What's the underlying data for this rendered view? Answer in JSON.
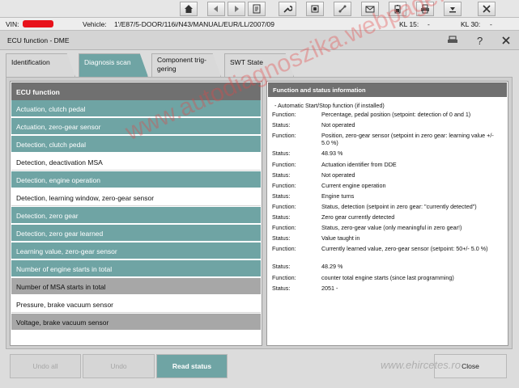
{
  "toolbar": {
    "buttons": [
      "home-icon",
      "back-icon",
      "forward-icon",
      "document-icon",
      "wrench-icon",
      "function-icon",
      "connection-icon",
      "mail-icon",
      "battery-icon",
      "print-icon",
      "dropdown-icon",
      "close-icon"
    ]
  },
  "infobar": {
    "vin_label": "VIN:",
    "vehicle_label": "Vehicle:",
    "vehicle_value": "1'/E87/5-DOOR/116i/N43/MANUAL/EUR/LL/2007/09",
    "kl15_label": "KL 15:",
    "kl15_value": "-",
    "kl30_label": "KL 30:",
    "kl30_value": "-"
  },
  "window": {
    "title": "ECU function - DME"
  },
  "tabs": [
    {
      "label": "Identification"
    },
    {
      "label": "Diagnosis scan"
    },
    {
      "label": "Component trig-\ngering"
    },
    {
      "label": "SWT State"
    }
  ],
  "ecu_panel": {
    "header": "ECU function",
    "rows": [
      "Actuation, clutch pedal",
      "Actuation, zero-gear sensor",
      "Detection, clutch pedal",
      "Detection, deactivation MSA",
      "Detection, engine operation",
      "Detection, learning window, zero-gear sensor",
      "Detection, zero gear",
      "Detection, zero gear learned",
      "Learning value, zero-gear sensor",
      "Number of engine starts in total",
      "Number of MSA starts in total",
      "Pressure, brake vacuum sensor",
      "Voltage, brake vacuum sensor"
    ]
  },
  "info_panel": {
    "header": "Function and status information",
    "heading": "- Automatic Start/Stop function (if installed)",
    "lines": [
      {
        "key": "Function:",
        "value": "Percentage, pedal position (setpoint: detection of 0 and 1)"
      },
      {
        "key": "Status:",
        "value": "Not operated"
      },
      {
        "key": "Function:",
        "value": "Position, zero-gear sensor (setpoint in zero gear: learning value +/- 5.0 %)"
      },
      {
        "key": "Status:",
        "value": "48.93 %"
      },
      {
        "key": "Function:",
        "value": "Actuation identifier from DDE"
      },
      {
        "key": "Status:",
        "value": "Not operated"
      },
      {
        "key": "Function:",
        "value": "Current engine operation"
      },
      {
        "key": "Status:",
        "value": "Engine turns"
      },
      {
        "key": "Function:",
        "value": "Status, detection (setpoint in zero gear: \"currently detected\")"
      },
      {
        "key": "Status:",
        "value": "Zero gear currently detected"
      },
      {
        "key": "Function:",
        "value": "Status, zero-gear value (only meaningful in zero gear!)"
      },
      {
        "key": "Status:",
        "value": "Value taught in"
      },
      {
        "key": "Function:",
        "value": "Currently learned value, zero-gear sensor (setpoint: 50+/- 5.0 %)"
      },
      {
        "key": "Status:",
        "value": "48.29 %"
      },
      {
        "key": "Function:",
        "value": "counter total engine starts (since last programming)"
      },
      {
        "key": "Status:",
        "value": "2051 -"
      }
    ]
  },
  "buttons": {
    "undo_all": "Undo all",
    "undo": "Undo",
    "read_status": "Read status",
    "close": "Close"
  },
  "watermarks": {
    "center": "www.autodiagnoszika.webpage.com",
    "bottom": "www.ehircetes.ro"
  },
  "colors": {
    "accent_teal": "#6fa4a4",
    "header_gray": "#707070",
    "selected_gray": "#a7a7a7",
    "redaction": "#e8121b"
  }
}
